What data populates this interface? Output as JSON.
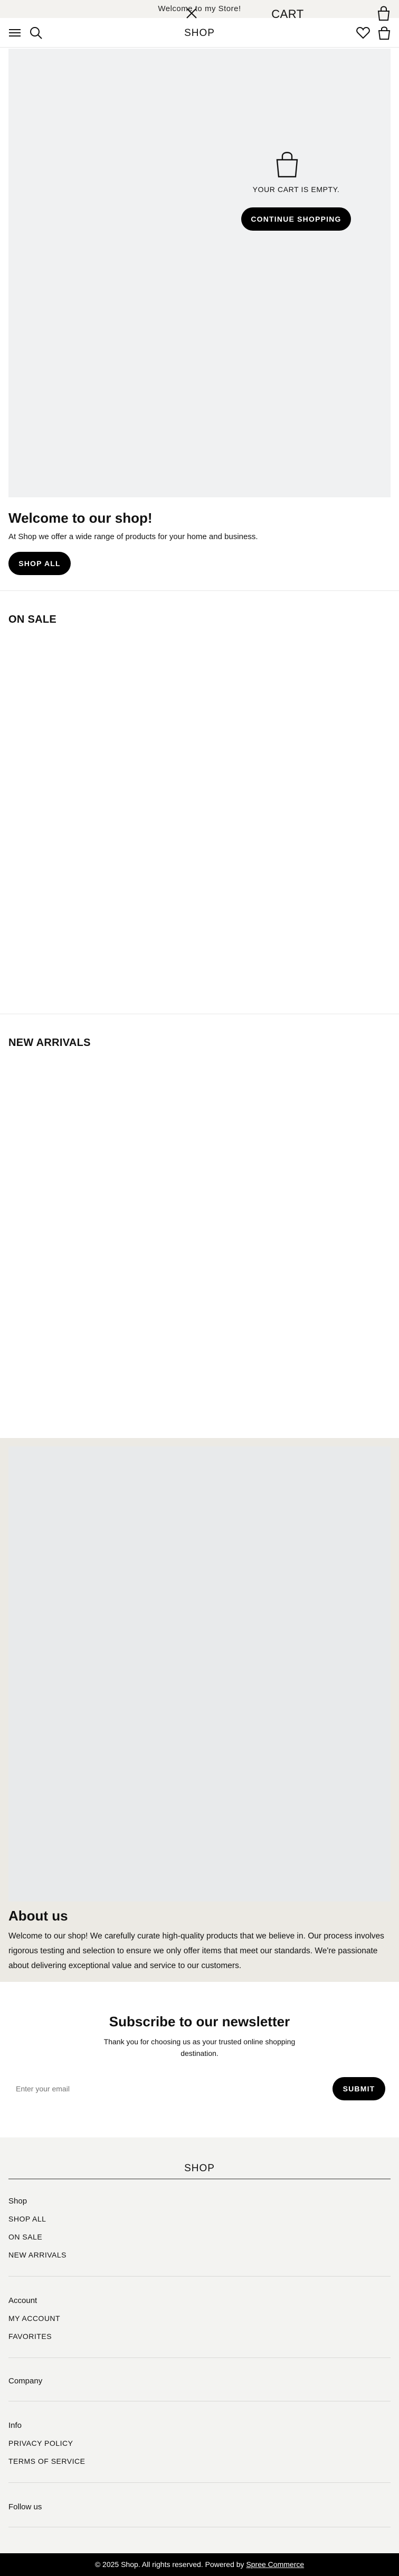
{
  "announcement": {
    "text": "Welcome to my Store!"
  },
  "header": {
    "title": "SHOP"
  },
  "cart": {
    "title": "CART",
    "empty_message": "YOUR CART IS EMPTY.",
    "continue_label": "CONTINUE SHOPPING"
  },
  "welcome": {
    "title": "Welcome to our shop!",
    "text": "At Shop we offer a wide range of products for your home and business.",
    "cta_label": "SHOP ALL"
  },
  "sections": {
    "on_sale": "ON SALE",
    "new_arrivals": "NEW ARRIVALS"
  },
  "about": {
    "title": "About us",
    "text": "Welcome to our shop! We carefully curate high-quality products that we believe in. Our process involves rigorous testing and selection to ensure we only offer items that meet our standards. We're passionate about delivering exceptional value and service to our customers."
  },
  "newsletter": {
    "title": "Subscribe to our newsletter",
    "subtitle": "Thank you for choosing us as your trusted online shopping destination.",
    "email_placeholder": "Enter your email",
    "submit_label": "SUBMIT"
  },
  "footer": {
    "brand": "SHOP",
    "shop_heading": "Shop",
    "shop_links": [
      "SHOP ALL",
      "ON SALE",
      "NEW ARRIVALS"
    ],
    "account_heading": "Account",
    "account_links": [
      "MY ACCOUNT",
      "FAVORITES"
    ],
    "company_heading": "Company",
    "info_heading": "Info",
    "info_links": [
      "PRIVACY POLICY",
      "TERMS OF SERVICE"
    ],
    "follow_heading": "Follow us"
  },
  "copyright": {
    "text": "© 2025 Shop. All rights reserved.  Powered by",
    "link_label": "Spree Commerce"
  }
}
